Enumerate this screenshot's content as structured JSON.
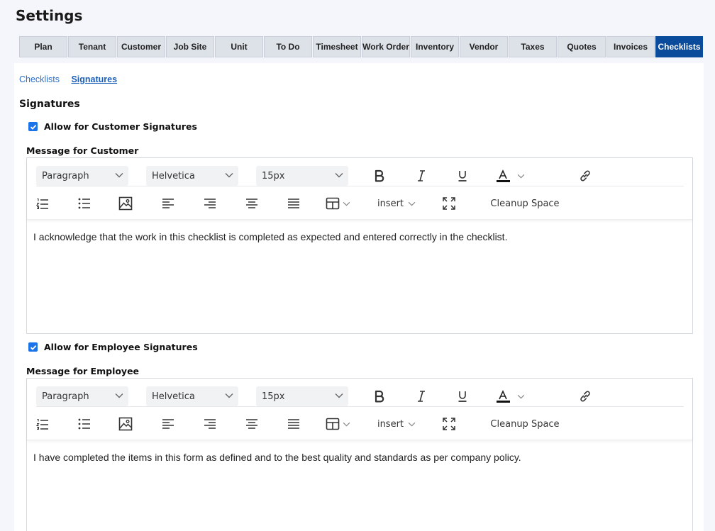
{
  "page": {
    "title": "Settings"
  },
  "tabs": [
    {
      "label": "Plan",
      "active": false
    },
    {
      "label": "Tenant",
      "active": false
    },
    {
      "label": "Customer",
      "active": false
    },
    {
      "label": "Job Site",
      "active": false
    },
    {
      "label": "Unit",
      "active": false
    },
    {
      "label": "To Do",
      "active": false
    },
    {
      "label": "Timesheet",
      "active": false
    },
    {
      "label": "Work Order",
      "active": false
    },
    {
      "label": "Inventory",
      "active": false
    },
    {
      "label": "Vendor",
      "active": false
    },
    {
      "label": "Taxes",
      "active": false
    },
    {
      "label": "Quotes",
      "active": false
    },
    {
      "label": "Invoices",
      "active": false
    },
    {
      "label": "Checklists",
      "active": true
    }
  ],
  "subnav": {
    "checklists": "Checklists",
    "signatures": "Signatures"
  },
  "section": {
    "title": "Signatures"
  },
  "customer": {
    "checkbox_label": "Allow for Customer Signatures",
    "checked": true,
    "message_label": "Message for Customer",
    "content": "I acknowledge that the work in this checklist is completed as expected and entered correctly in the checklist."
  },
  "employee": {
    "checkbox_label": "Allow for Employee Signatures",
    "checked": true,
    "message_label": "Message for Employee",
    "content": "I have completed the items in this form as defined and to the best quality and standards as per company policy."
  },
  "toolbar": {
    "block_format": "Paragraph",
    "font_family": "Helvetica",
    "font_size": "15px",
    "insert_label": "insert",
    "cleanup_label": "Cleanup Space"
  },
  "colors": {
    "accent": "#0a4b9c",
    "link": "#2a6fc9",
    "checkbox": "#1a73e8"
  }
}
